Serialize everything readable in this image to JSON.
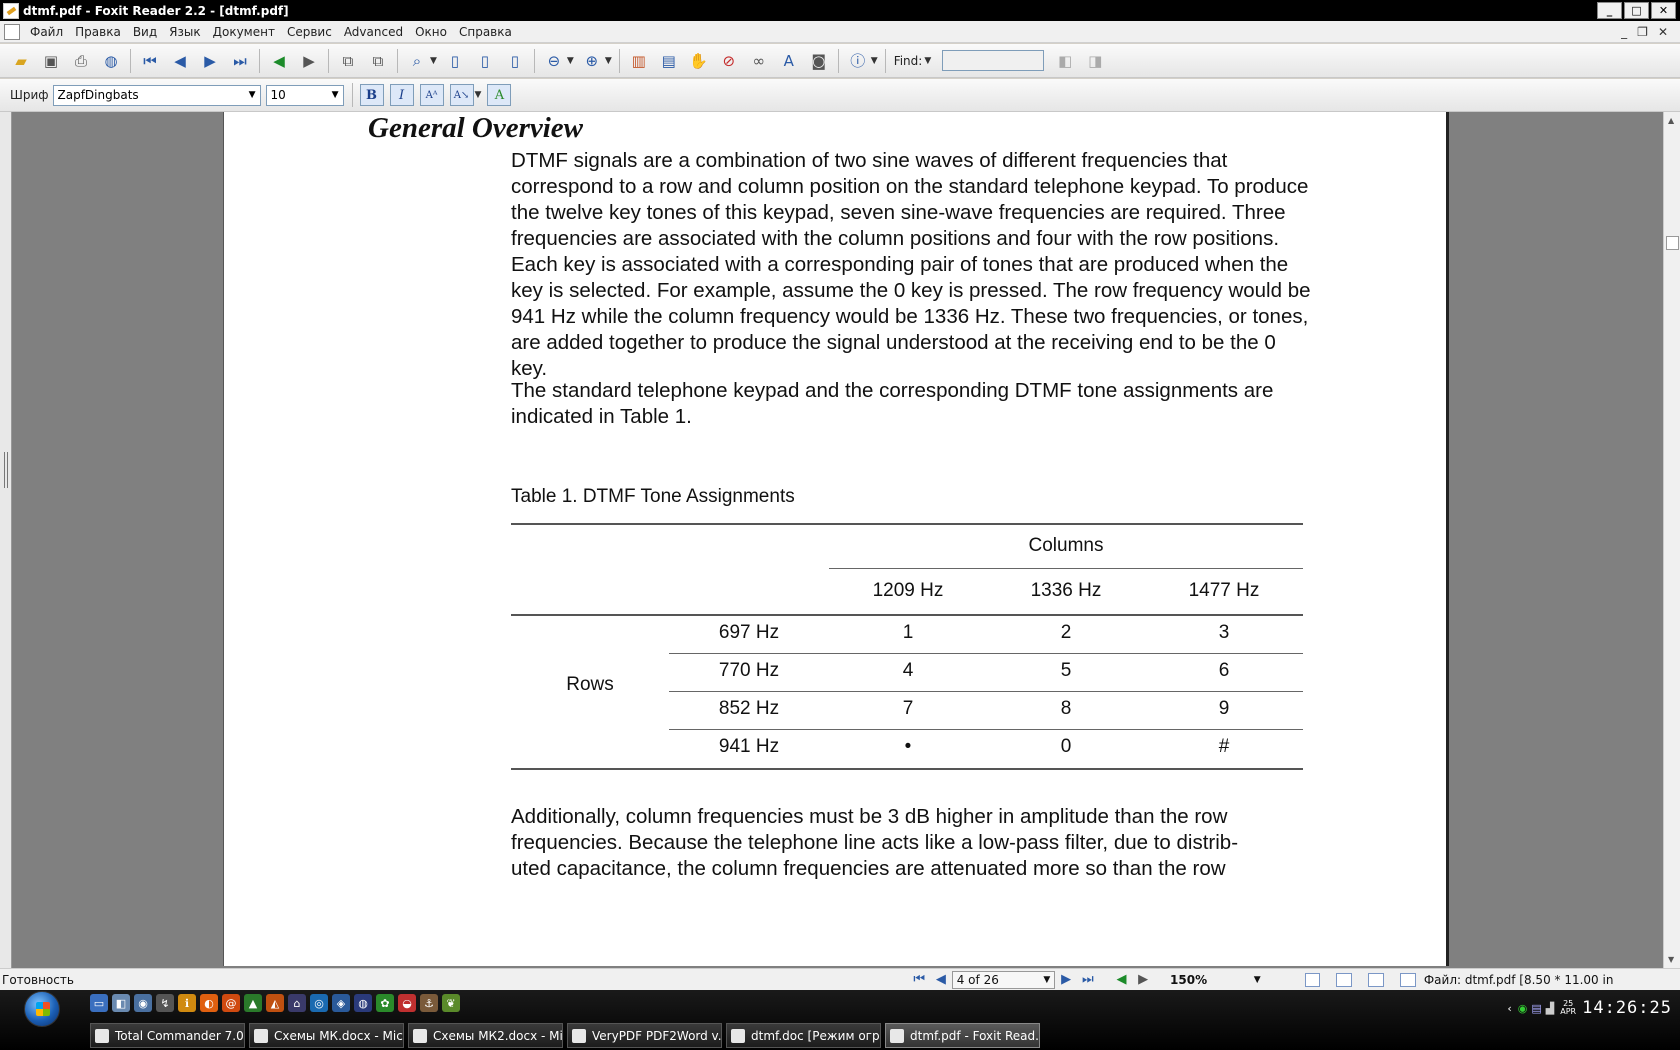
{
  "window": {
    "title": "dtmf.pdf - Foxit Reader 2.2 - [dtmf.pdf]",
    "controls": [
      "minimize",
      "maximize",
      "close"
    ]
  },
  "menu": {
    "items": [
      "Файл",
      "Правка",
      "Вид",
      "Язык",
      "Документ",
      "Сервис",
      "Advanced",
      "Окно",
      "Справка"
    ]
  },
  "toolbar": {
    "find_label": "Find:",
    "find_value": ""
  },
  "format_toolbar": {
    "font_label": "Шриф",
    "font_value": "ZapfDingbats",
    "size_value": "10"
  },
  "document": {
    "heading": "General Overview",
    "para1": "DTMF signals are a combination of two sine waves of different frequencies that correspond to a row and column position on the standard telephone keypad. To produce the twelve key tones of this keypad, seven sine-wave frequencies are required. Three frequencies are associated with the column positions and four with the row positions. Each key is associated with a corresponding pair of tones that are produced when the key is selected. For example, assume the 0 key is pressed. The row frequency would be 941 Hz while the column frequency would be 1336 Hz. These two frequencies, or tones, are added together to produce the signal understood at the receiving end to be the 0 key.",
    "para2": "The standard telephone keypad and the corresponding DTMF tone assignments are indicated in Table 1.",
    "table_caption": "Table 1. DTMF Tone Assignments",
    "table": {
      "columns_label": "Columns",
      "rows_label": "Rows",
      "col_headers": [
        "1209 Hz",
        "1336 Hz",
        "1477 Hz"
      ],
      "rows": [
        {
          "freq": "697 Hz",
          "keys": [
            "1",
            "2",
            "3"
          ]
        },
        {
          "freq": "770 Hz",
          "keys": [
            "4",
            "5",
            "6"
          ]
        },
        {
          "freq": "852 Hz",
          "keys": [
            "7",
            "8",
            "9"
          ]
        },
        {
          "freq": "941 Hz",
          "keys": [
            "•",
            "0",
            "#"
          ]
        }
      ]
    },
    "para3_lines": [
      "Additionally, column frequencies must be 3 dB higher in amplitude than the row",
      "frequencies. Because the telephone line acts like a low-pass filter, due to distrib-",
      "uted capacitance,  the column frequencies are attenuated more so than the row"
    ]
  },
  "status": {
    "text": "Готовность",
    "page": "4 of 26",
    "zoom": "150%",
    "file_info": "Файл: dtmf.pdf [8.50 * 11.00 in"
  },
  "taskbar": {
    "tasks": [
      {
        "label": "Total Commander 7.0..."
      },
      {
        "label": "Схемы МК.docx - Mic..."
      },
      {
        "label": "Схемы МК2.docx - Mi..."
      },
      {
        "label": "VeryPDF PDF2Word v..."
      },
      {
        "label": "dtmf.doc [Режим огр..."
      },
      {
        "label": "dtmf.pdf - Foxit Read..."
      }
    ],
    "date_day": "25",
    "date_month": "APR",
    "clock": "14:26:25"
  }
}
